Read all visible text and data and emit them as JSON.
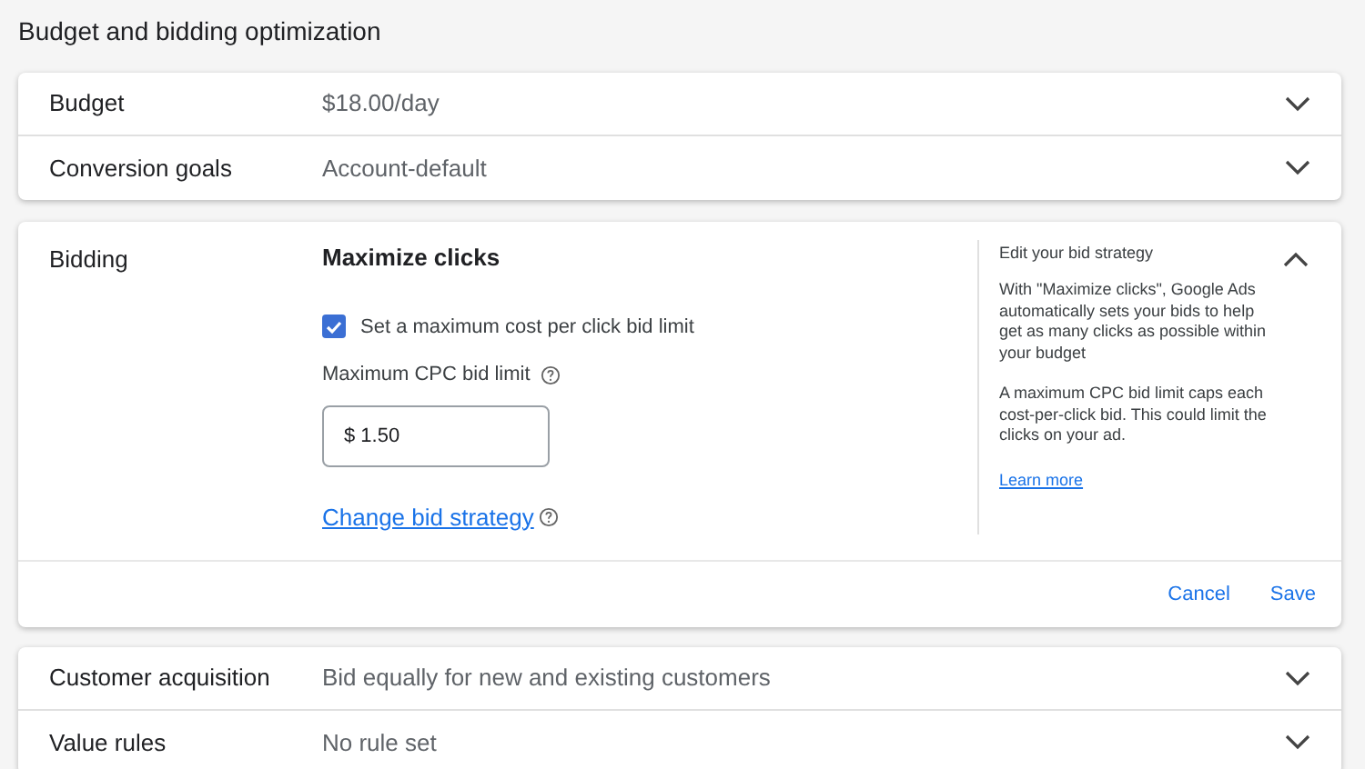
{
  "title": "Budget and bidding optimization",
  "sections": [
    {
      "label": "Budget",
      "value": "$18.00/day",
      "expanded": false
    },
    {
      "label": "Conversion goals",
      "value": "Account-default",
      "expanded": false
    },
    {
      "label": "Bidding",
      "expanded": true,
      "strategy": "Maximize clicks",
      "checkbox": {
        "label": "Set a maximum cost per click bid limit",
        "checked": true
      },
      "field": {
        "label": "Maximum CPC bid limit",
        "value": "$ 1.50"
      },
      "link": "Change bid strategy",
      "help": {
        "title": "Edit your bid strategy",
        "paragraphs": [
          "With \"Maximize clicks\", Google Ads automatically sets your bids to help get as many clicks as possible within your budget",
          "A maximum CPC bid limit caps each cost-per-click bid. This could limit the clicks on your ad."
        ],
        "link": "Learn more"
      },
      "buttons": [
        "Cancel",
        "Save"
      ]
    },
    {
      "label": "Customer acquisition",
      "value": "Bid equally for new and existing customers",
      "expanded": false
    },
    {
      "label": "Value rules",
      "value": "No rule set",
      "expanded": false
    }
  ]
}
